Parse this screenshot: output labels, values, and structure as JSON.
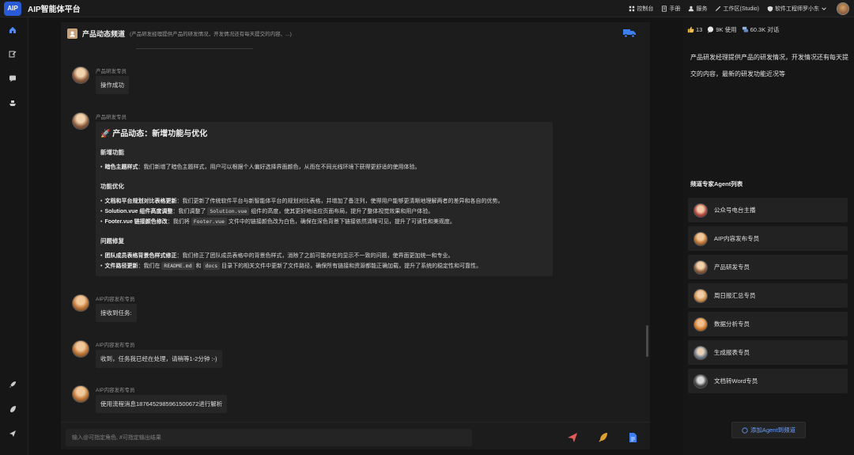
{
  "app": {
    "logo": "AIP",
    "title": "AIP智能体平台"
  },
  "topbar": {
    "actions": [
      {
        "label": "控制台",
        "icon": "console-icon"
      },
      {
        "label": "手册",
        "icon": "manual-icon"
      },
      {
        "label": "服务",
        "icon": "service-icon"
      },
      {
        "label": "工作区(Studio)",
        "icon": "studio-icon"
      },
      {
        "label": "软件工程师罗小东",
        "icon": "user-shield-icon"
      }
    ]
  },
  "channel": {
    "name": "产品动态频道",
    "description": "(产品研发经理提供产品的研发情况，开发情况还有每天提交的内容、...)"
  },
  "messages": [
    {
      "sender": "产品研发专员",
      "text": "操作成功"
    },
    {
      "sender": "产品研发专员",
      "rich": {
        "title": "🚀 产品动态：新增功能与优化",
        "sections": [
          {
            "heading": "新增功能",
            "items": [
              {
                "bold": "暗色主题样式",
                "text": "：我们新增了暗色主题样式，用户可以根据个人偏好选择界面颜色，从而在不同光线环境下获得更舒适的使用体验。"
              }
            ]
          },
          {
            "heading": "功能优化",
            "items": [
              {
                "bold": "文档和平台规划对比表格更新",
                "text": "：我们更新了传统软件平台与新智能体平台的规划对比表格，并增加了备注列，使得用户能够更清晰地理解两者的差异和各自的优势。"
              },
              {
                "bold": "Solution.vue 组件高度调整",
                "pre": "：我们调整了 ",
                "code": "Solution.vue",
                "post": " 组件的高度，使其更好地适应页面布局，提升了整体视觉效果和用户体验。"
              },
              {
                "bold": "Footer.vue 链接颜色修改",
                "pre": "：我们将 ",
                "code": "Footer.vue",
                "post": " 文件中的链接颜色改为白色，确保在深色背景下链接依然清晰可见，提升了可读性和美观度。"
              }
            ]
          },
          {
            "heading": "问题修复",
            "items": [
              {
                "bold": "团队成员表格背景色样式修正",
                "text": "：我们修正了团队成员表格中的背景色样式，消除了之前可能存在的显示不一致的问题，使界面更加统一和专业。"
              },
              {
                "bold": "文件路径更新",
                "pre": "：我们在 ",
                "code": "README.md",
                "mid": " 和 ",
                "code2": "docs",
                "post": " 目录下的相关文件中更新了文件路径，确保所有链接和资源都能正确加载，提升了系统的稳定性和可靠性。"
              }
            ]
          }
        ]
      }
    },
    {
      "sender": "AIP内容发布专员",
      "text": "接收到任务:"
    },
    {
      "sender": "AIP内容发布专员",
      "text": "收到，任务我已经在处理，请稍等1-2分钟 :-)"
    },
    {
      "sender": "AIP内容发布专员",
      "text": "使用流程消息1876452985961500672进行解析"
    }
  ],
  "input": {
    "placeholder": "输入@可指定角色, #可指定输出结果"
  },
  "stats": {
    "likes": "13",
    "usage": "9K 使用",
    "conversations": "60.3K 对话"
  },
  "right_panel": {
    "description": "产品研发经理提供产品的研发情况，开发情况还有每天提交的内容，最新的研发功能近况等",
    "list_title": "频道专家Agent列表",
    "agents": [
      {
        "name": "公众号电台主播"
      },
      {
        "name": "AIP内容发布专员"
      },
      {
        "name": "产品研发专员"
      },
      {
        "name": "周日报汇总专员"
      },
      {
        "name": "数据分析专员"
      },
      {
        "name": "生成报表专员"
      },
      {
        "name": "文档转Word专员"
      }
    ],
    "add_button": "添加Agent到频道"
  },
  "colors": {
    "accent": "#2a5bd7",
    "link": "#6aa0ff",
    "send": "#e05a5a",
    "pen": "#e0a030",
    "doc": "#3d7ef0"
  }
}
